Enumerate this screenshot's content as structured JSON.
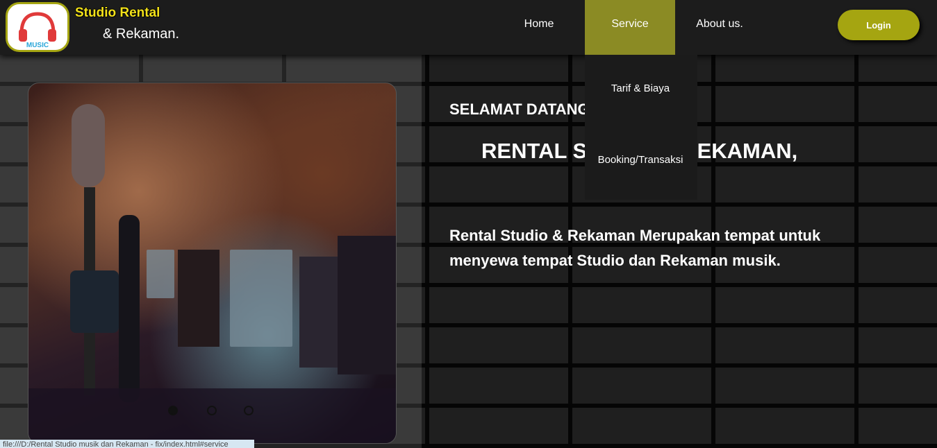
{
  "brand": {
    "logo_icon": "headphones-icon",
    "logo_text": "MUSIC",
    "line1": "Studio Rental",
    "line2": "& Rekaman."
  },
  "nav": {
    "home": "Home",
    "service": "Service",
    "about": "About us.",
    "login": "Login"
  },
  "dropdown": {
    "items": [
      "Tarif & Biaya",
      "Booking/Transaksi"
    ]
  },
  "hero": {
    "welcome": "SELAMAT DATANG",
    "headline": "RENTAL STUDIO & REKAMAN,",
    "description": "Rental Studio & Rekaman Merupakan tempat untuk menyewa tempat Studio dan Rekaman musik."
  },
  "carousel": {
    "active_index": 0,
    "dot_count": 3
  },
  "status_bar": {
    "url": "file:///D:/Rental Studio musik dan Rekaman - fix/index.html#service"
  },
  "colors": {
    "accent": "#a5a511",
    "service_active": "#8b8b24",
    "brand_yellow": "#f2e11a"
  }
}
